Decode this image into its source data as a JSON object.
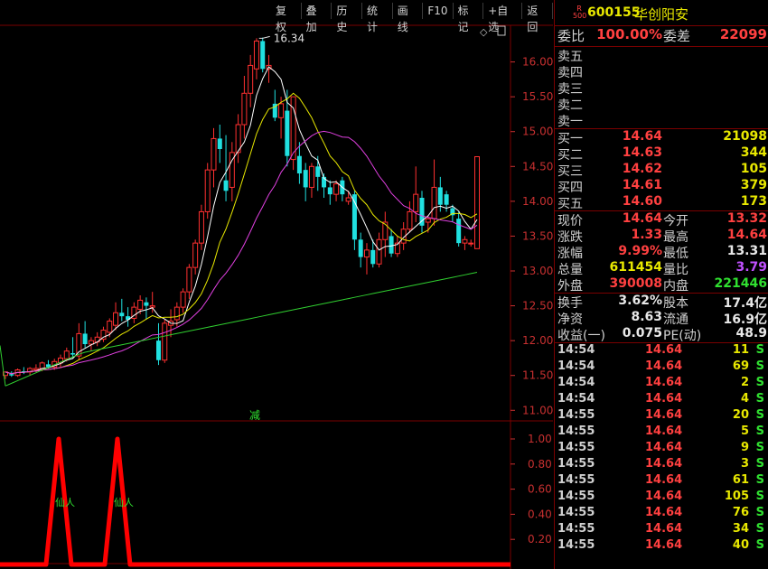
{
  "toolbar": {
    "buttons": [
      "复权",
      "叠加",
      "历史",
      "统计",
      "画线",
      "F10",
      "标记",
      "+自选",
      "返回"
    ]
  },
  "chart": {
    "high_label": "16.34",
    "annotation": "减",
    "signal_label": "仙人",
    "price_axis": [
      "16.00",
      "15.50",
      "15.00",
      "14.50",
      "14.00",
      "13.50",
      "13.00",
      "12.50",
      "12.00",
      "11.50",
      "11.00"
    ],
    "ind_axis": [
      "1.00",
      "0.80",
      "0.60",
      "0.40",
      "0.20"
    ],
    "colors": {
      "up": "#ff3030",
      "down": "#20e0e0",
      "ma5": "#ffffff",
      "ma10": "#e8e800",
      "ma20": "#e040e0",
      "ma60": "#30d030",
      "signal": "#ff0000",
      "axis": "#c83030"
    }
  },
  "chart_data": {
    "type": "candlestick",
    "ylim": [
      10.9,
      16.5
    ],
    "candles": [
      [
        11.5,
        11.55,
        11.45,
        11.55
      ],
      [
        11.52,
        11.56,
        11.48,
        11.5
      ],
      [
        11.5,
        11.6,
        11.48,
        11.58
      ],
      [
        11.56,
        11.62,
        11.52,
        11.55
      ],
      [
        11.55,
        11.62,
        11.5,
        11.6
      ],
      [
        11.58,
        11.66,
        11.55,
        11.6
      ],
      [
        11.6,
        11.7,
        11.56,
        11.68
      ],
      [
        11.66,
        11.72,
        11.6,
        11.62
      ],
      [
        11.62,
        11.74,
        11.58,
        11.7
      ],
      [
        11.68,
        11.8,
        11.62,
        11.75
      ],
      [
        11.74,
        11.9,
        11.7,
        11.85
      ],
      [
        11.82,
        12.05,
        11.75,
        11.8
      ],
      [
        11.78,
        12.25,
        11.72,
        12.1
      ],
      [
        12.1,
        12.28,
        11.9,
        11.95
      ],
      [
        11.95,
        12.05,
        11.85,
        12.0
      ],
      [
        11.98,
        12.12,
        11.92,
        12.05
      ],
      [
        12.02,
        12.2,
        11.98,
        12.15
      ],
      [
        12.12,
        12.32,
        12.05,
        12.28
      ],
      [
        12.22,
        12.55,
        12.15,
        12.4
      ],
      [
        12.4,
        12.6,
        12.28,
        12.35
      ],
      [
        12.35,
        12.48,
        12.2,
        12.3
      ],
      [
        12.32,
        12.55,
        12.25,
        12.48
      ],
      [
        12.45,
        12.65,
        12.38,
        12.58
      ],
      [
        12.55,
        12.62,
        12.3,
        12.5
      ],
      [
        12.48,
        12.7,
        12.4,
        12.5
      ],
      [
        12.0,
        12.25,
        11.65,
        11.72
      ],
      [
        11.72,
        12.3,
        11.68,
        12.25
      ],
      [
        12.22,
        12.45,
        12.05,
        12.28
      ],
      [
        12.3,
        12.55,
        12.2,
        12.48
      ],
      [
        12.48,
        12.75,
        12.4,
        12.7
      ],
      [
        12.7,
        13.1,
        12.6,
        13.05
      ],
      [
        13.05,
        13.45,
        12.95,
        13.4
      ],
      [
        13.4,
        13.95,
        13.3,
        13.85
      ],
      [
        13.85,
        14.55,
        13.75,
        14.45
      ],
      [
        14.45,
        15.05,
        14.2,
        14.9
      ],
      [
        14.9,
        15.1,
        14.55,
        14.75
      ],
      [
        14.3,
        14.95,
        14.0,
        14.15
      ],
      [
        14.2,
        14.85,
        14.0,
        14.7
      ],
      [
        14.7,
        15.25,
        14.55,
        15.1
      ],
      [
        15.1,
        15.8,
        14.9,
        15.55
      ],
      [
        15.55,
        16.1,
        15.35,
        15.95
      ],
      [
        15.9,
        16.34,
        15.75,
        16.3
      ],
      [
        16.3,
        16.35,
        15.85,
        15.9
      ],
      [
        15.9,
        16.1,
        15.7,
        15.95
      ],
      [
        15.4,
        15.6,
        15.15,
        15.2
      ],
      [
        15.2,
        15.5,
        14.9,
        15.4
      ],
      [
        15.3,
        15.6,
        14.5,
        14.65
      ],
      [
        14.6,
        15.5,
        14.45,
        15.5
      ],
      [
        14.65,
        14.85,
        14.25,
        14.4
      ],
      [
        14.45,
        14.55,
        14.0,
        14.2
      ],
      [
        14.2,
        14.55,
        14.05,
        14.5
      ],
      [
        14.5,
        14.65,
        14.15,
        14.35
      ],
      [
        14.35,
        14.4,
        14.05,
        14.2
      ],
      [
        14.2,
        14.3,
        13.95,
        14.1
      ],
      [
        14.1,
        14.3,
        14.0,
        14.25
      ],
      [
        14.3,
        14.35,
        14.0,
        14.1
      ],
      [
        14.0,
        14.15,
        13.95,
        14.05
      ],
      [
        14.1,
        14.15,
        13.3,
        13.45
      ],
      [
        13.45,
        13.55,
        13.05,
        13.2
      ],
      [
        13.2,
        13.4,
        12.95,
        13.3
      ],
      [
        13.3,
        13.45,
        13.05,
        13.1
      ],
      [
        13.1,
        13.55,
        13.05,
        13.45
      ],
      [
        13.45,
        13.85,
        13.2,
        13.7
      ],
      [
        13.5,
        13.6,
        13.2,
        13.25
      ],
      [
        13.25,
        13.5,
        13.2,
        13.4
      ],
      [
        13.4,
        13.7,
        13.3,
        13.6
      ],
      [
        13.6,
        14.0,
        13.55,
        13.85
      ],
      [
        13.85,
        14.5,
        13.7,
        14.1
      ],
      [
        14.05,
        14.15,
        13.55,
        13.65
      ],
      [
        13.7,
        13.8,
        13.55,
        13.75
      ],
      [
        13.75,
        14.6,
        13.65,
        14.2
      ],
      [
        14.2,
        14.35,
        13.85,
        13.95
      ],
      [
        14.1,
        14.15,
        13.85,
        13.95
      ],
      [
        13.9,
        13.95,
        13.7,
        13.8
      ],
      [
        13.75,
        13.85,
        13.35,
        13.4
      ],
      [
        13.4,
        13.5,
        13.3,
        13.45
      ],
      [
        13.4,
        13.45,
        13.35,
        13.4
      ],
      [
        13.32,
        14.64,
        13.32,
        14.64
      ]
    ],
    "signal_peaks": [
      0.115,
      0.23
    ]
  },
  "quote": {
    "logo": "R 500",
    "code": "600155",
    "name": "华创阳安",
    "weibi_label": "委比",
    "weibi": "100.00%",
    "weicha_label": "委差",
    "weicha": "22099",
    "sells": [
      {
        "label": "卖五",
        "price": "",
        "vol": ""
      },
      {
        "label": "卖四",
        "price": "",
        "vol": ""
      },
      {
        "label": "卖三",
        "price": "",
        "vol": ""
      },
      {
        "label": "卖二",
        "price": "",
        "vol": ""
      },
      {
        "label": "卖一",
        "price": "",
        "vol": ""
      }
    ],
    "buys": [
      {
        "label": "买一",
        "price": "14.64",
        "vol": "21098"
      },
      {
        "label": "买二",
        "price": "14.63",
        "vol": "344"
      },
      {
        "label": "买三",
        "price": "14.62",
        "vol": "105"
      },
      {
        "label": "买四",
        "price": "14.61",
        "vol": "379"
      },
      {
        "label": "买五",
        "price": "14.60",
        "vol": "173"
      }
    ],
    "stats": [
      {
        "l1": "现价",
        "v1": "14.64",
        "c1": "red",
        "l2": "今开",
        "v2": "13.32",
        "c2": "red"
      },
      {
        "l1": "涨跌",
        "v1": "1.33",
        "c1": "red",
        "l2": "最高",
        "v2": "14.64",
        "c2": "red"
      },
      {
        "l1": "涨幅",
        "v1": "9.99%",
        "c1": "red",
        "l2": "最低",
        "v2": "13.31",
        "c2": "wht"
      },
      {
        "l1": "总量",
        "v1": "611454",
        "c1": "yel",
        "l2": "量比",
        "v2": "3.79",
        "c2": "pur"
      },
      {
        "l1": "外盘",
        "v1": "390008",
        "c1": "red",
        "l2": "内盘",
        "v2": "221446",
        "c2": "grn"
      }
    ],
    "info": [
      {
        "l1": "换手",
        "v1": "3.62%",
        "l2": "股本",
        "v2": "17.4亿"
      },
      {
        "l1": "净资",
        "v1": "8.63",
        "l2": "流通",
        "v2": "16.9亿"
      },
      {
        "l1": "收益(一)",
        "v1": "0.075",
        "l2": "PE(动)",
        "v2": "48.9"
      }
    ],
    "trades": [
      {
        "time": "14:54",
        "price": "14.64",
        "vol": "11",
        "side": "S"
      },
      {
        "time": "14:54",
        "price": "14.64",
        "vol": "69",
        "side": "S"
      },
      {
        "time": "14:54",
        "price": "14.64",
        "vol": "2",
        "side": "S"
      },
      {
        "time": "14:54",
        "price": "14.64",
        "vol": "4",
        "side": "S"
      },
      {
        "time": "14:55",
        "price": "14.64",
        "vol": "20",
        "side": "S"
      },
      {
        "time": "14:55",
        "price": "14.64",
        "vol": "5",
        "side": "S"
      },
      {
        "time": "14:55",
        "price": "14.64",
        "vol": "9",
        "side": "S"
      },
      {
        "time": "14:55",
        "price": "14.64",
        "vol": "3",
        "side": "S"
      },
      {
        "time": "14:55",
        "price": "14.64",
        "vol": "61",
        "side": "S"
      },
      {
        "time": "14:55",
        "price": "14.64",
        "vol": "105",
        "side": "S"
      },
      {
        "time": "14:55",
        "price": "14.64",
        "vol": "76",
        "side": "S"
      },
      {
        "time": "14:55",
        "price": "14.64",
        "vol": "34",
        "side": "S"
      },
      {
        "time": "14:55",
        "price": "14.64",
        "vol": "40",
        "side": "S"
      }
    ]
  }
}
